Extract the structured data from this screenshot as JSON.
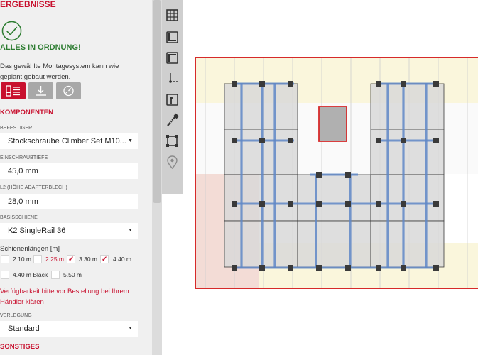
{
  "panel": {
    "title": "ERGEBNISSE",
    "status_title": "ALLES IN ORDNUNG!",
    "status_desc": "Das gewählte Montagesystem kann wie geplant gebaut werden.",
    "tabs": [
      {
        "name": "list-view",
        "icon": "list-icon",
        "active": true
      },
      {
        "name": "export",
        "icon": "download-icon",
        "active": false
      },
      {
        "name": "settings",
        "icon": "gauge-icon",
        "active": false
      }
    ],
    "components_title": "KOMPONENTEN",
    "fastener": {
      "label": "BEFESTIGER",
      "value": "Stockschraube Climber Set M10..."
    },
    "depth": {
      "label": "EINSCHRAUBTIEFE",
      "value": "45,0 mm"
    },
    "l2": {
      "label": "L2 (HÖHE ADAPTERBLECH)",
      "value": "28,0 mm"
    },
    "rail": {
      "label": "BASISSCHIENE",
      "value": "K2 SingleRail 36"
    },
    "rail_lengths": {
      "label": "Schienenlängen [m]",
      "options": [
        {
          "label": "2.10 m",
          "checked": false,
          "highlight": false
        },
        {
          "label": "2.25 m",
          "checked": false,
          "highlight": true
        },
        {
          "label": "3.30 m",
          "checked": true,
          "highlight": false
        },
        {
          "label": "4.40 m",
          "checked": true,
          "highlight": false
        },
        {
          "label": "4.40 m Black",
          "checked": false,
          "highlight": false
        },
        {
          "label": "5.50 m",
          "checked": false,
          "highlight": false
        }
      ]
    },
    "availability_note": "Verfügbarkeit bitte vor Bestellung bei Ihrem Händler klären",
    "layout": {
      "label": "VERLEGUNG",
      "value": "Standard"
    },
    "misc_title": "SONSTIGES"
  },
  "toolbar": {
    "tools": [
      "grid-icon",
      "edge-bottom-icon",
      "edge-top-icon",
      "axis-icon",
      "hook-icon",
      "screw-icon",
      "frame-icon",
      "location-icon"
    ]
  },
  "colors": {
    "accent_red": "#c8102e",
    "ok_green": "#2e7d32",
    "rail_blue": "#5f87c7",
    "roof_zone_yellow": "#faf6dc",
    "roof_zone_pink": "#f3dcd6"
  }
}
